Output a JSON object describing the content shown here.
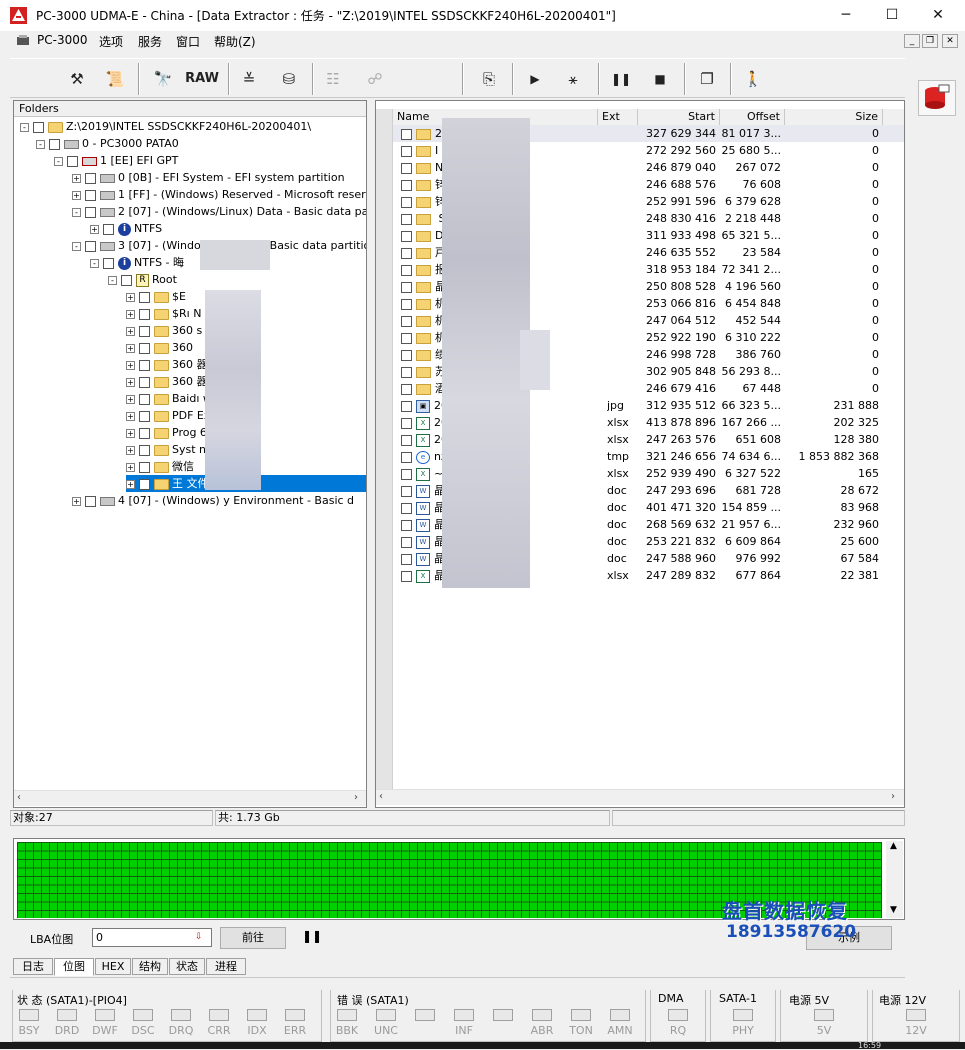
{
  "window": {
    "title": "PC-3000 UDMA-E - China - [Data Extractor : 任务 - \"Z:\\2019\\INTEL SSDSCKKF240H6L-20200401\"]",
    "minimize": "─",
    "maximize": "☐",
    "close": "✕",
    "mdi_min": "_",
    "mdi_restore": "❐",
    "mdi_close": "✕"
  },
  "menu": [
    "PC-3000",
    "选项",
    "服务",
    "窗口",
    "帮助(Z)"
  ],
  "toolbar": {
    "raw_label": "RAW",
    "icons": [
      "tools-icon",
      "scroll-icon",
      "binoculars-icon",
      "raw-button",
      "tree-compare-icon",
      "disk-icon",
      "tree-icon",
      "network-icon",
      "map-disk-icon",
      "play-icon",
      "branch-icon",
      "pause-icon",
      "stop-icon",
      "copy-windows-icon",
      "exit-icon"
    ]
  },
  "folders": {
    "header": "Folders",
    "items": [
      {
        "label": "Z:\\2019\\INTEL SSDSCKKF240H6L-20200401\\",
        "exp": "-",
        "icon": "task",
        "depth": 0
      },
      {
        "label": "0 - PC3000 PATA0",
        "exp": "-",
        "icon": "drive",
        "depth": 1
      },
      {
        "label": "1 [EE] EFI GPT",
        "exp": "-",
        "icon": "gpt",
        "depth": 2
      },
      {
        "label": "0 [0B] - EFI System - EFI system partition",
        "exp": "+",
        "icon": "drive",
        "depth": 3
      },
      {
        "label": "1 [FF] - (Windows) Reserved - Microsoft reserved p",
        "exp": "+",
        "icon": "drive",
        "depth": 3
      },
      {
        "label": "2 [07] - (Windows/Linux) Data - Basic data partition",
        "exp": "-",
        "icon": "drive",
        "depth": 3
      },
      {
        "label": "NTFS",
        "exp": "+",
        "icon": "info",
        "depth": 4
      },
      {
        "label": "3 [07] - (Windo    nux) Data - Basic data partition",
        "exp": "-",
        "icon": "drive",
        "depth": 3
      },
      {
        "label": "NTFS - 晦",
        "exp": "-",
        "icon": "info",
        "depth": 4
      },
      {
        "label": "Root",
        "exp": "-",
        "icon": "root",
        "depth": 5
      },
      {
        "label": "$E",
        "exp": "+",
        "icon": "folder",
        "depth": 6
      },
      {
        "label": "$Rı          N",
        "exp": "+",
        "icon": "folder",
        "depth": 6
      },
      {
        "label": "360          s",
        "exp": "+",
        "icon": "folder",
        "depth": 6
      },
      {
        "label": "360",
        "exp": "+",
        "icon": "folder",
        "depth": 6
      },
      {
        "label": "360          器下载",
        "exp": "+",
        "icon": "folder",
        "depth": 6
      },
      {
        "label": "360          器下载",
        "exp": "+",
        "icon": "folder",
        "depth": 6
      },
      {
        "label": "Baidı          wnload",
        "exp": "+",
        "icon": "folder",
        "depth": 6
      },
      {
        "label": "PDF          Excel工具",
        "exp": "+",
        "icon": "folder",
        "depth": 6
      },
      {
        "label": "Prog          6)",
        "exp": "+",
        "icon": "folder",
        "depth": 6
      },
      {
        "label": "Syst          nformation",
        "exp": "+",
        "icon": "folder",
        "depth": 6
      },
      {
        "label": "微信",
        "exp": "+",
        "icon": "folder",
        "depth": 6
      },
      {
        "label": "王          文件夹",
        "exp": "+",
        "icon": "folder",
        "depth": 6,
        "selected": true
      },
      {
        "label": "4 [07] - (Windows)       y Environment - Basic d",
        "exp": "+",
        "icon": "drive",
        "depth": 3
      }
    ]
  },
  "files": {
    "columns": [
      "Name",
      "Ext",
      "Start",
      "Offset",
      "Size"
    ],
    "rows": [
      {
        "name": "2",
        "ext": "",
        "start": "327 629 344",
        "offset": "81 017 3...",
        "size": "0",
        "type": "folder"
      },
      {
        "name": "I",
        "ext": "",
        "start": "272 292 560",
        "offset": "25 680 5...",
        "size": "0",
        "type": "folder"
      },
      {
        "name": "N",
        "ext": "",
        "start": "246 879 040",
        "offset": "267 072",
        "size": "0",
        "type": "folder"
      },
      {
        "name": "锌",
        "ext": "",
        "start": "246 688 576",
        "offset": "76 608",
        "size": "0",
        "type": "folder"
      },
      {
        "name": "锌          息登录",
        "ext": "",
        "start": "252 991 596",
        "offset": "6 379 628",
        "size": "0",
        "type": "folder"
      },
      {
        "name": "          Selina",
        "ext": "",
        "start": "248 830 416",
        "offset": "2 218 448",
        "size": "0",
        "type": "folder"
      },
      {
        "name": "D          –",
        "ext": "",
        "start": "311 933 498",
        "offset": "65 321 5...",
        "size": "0",
        "type": "folder"
      },
      {
        "name": "戸",
        "ext": "",
        "start": "246 635 552",
        "offset": "23 584",
        "size": "0",
        "type": "folder"
      },
      {
        "name": "报",
        "ext": "",
        "start": "318 953 184",
        "offset": "72 341 2...",
        "size": "0",
        "type": "folder"
      },
      {
        "name": "晶",
        "ext": "",
        "start": "250 808 528",
        "offset": "4 196 560",
        "size": "0",
        "type": "folder"
      },
      {
        "name": "机",
        "ext": "",
        "start": "253 066 816",
        "offset": "6 454 848",
        "size": "0",
        "type": "folder"
      },
      {
        "name": "机",
        "ext": "",
        "start": "247 064 512",
        "offset": "452 544",
        "size": "0",
        "type": "folder"
      },
      {
        "name": "机",
        "ext": "",
        "start": "252 922 190",
        "offset": "6 310 222",
        "size": "0",
        "type": "folder"
      },
      {
        "name": "绩",
        "ext": "",
        "start": "246 998 728",
        "offset": "386 760",
        "size": "0",
        "type": "folder"
      },
      {
        "name": "苏",
        "ext": "",
        "start": "302 905 848",
        "offset": "56 293 8...",
        "size": "0",
        "type": "folder"
      },
      {
        "name": "酒",
        "ext": "",
        "start": "246 679 416",
        "offset": "67 448",
        "size": "0",
        "type": "folder"
      },
      {
        "name": "20          .jpg",
        "ext": "jpg",
        "start": "312 935 512",
        "offset": "66 323 5...",
        "size": "231 888",
        "type": "jpg"
      },
      {
        "name": "20          汇总-王...",
        "ext": "xlsx",
        "start": "413 878 896",
        "offset": "167 266 ...",
        "size": "202 325",
        "type": "xlsx"
      },
      {
        "name": "20          汇总-龚...",
        "ext": "xlsx",
        "start": "247 263 576",
        "offset": "651 608",
        "size": "128 380",
        "type": "xlsx"
      },
      {
        "name": "nzp",
        "ext": "tmp",
        "start": "321 246 656",
        "offset": "74 634 6...",
        "size": "1 853 882 368",
        "type": "tmp"
      },
      {
        "name": "~$2          备清单...",
        "ext": "xlsx",
        "start": "252 939 490",
        "offset": "6 327 522",
        "size": "165",
        "type": "xlsx"
      },
      {
        "name": "晶",
        "ext": "doc",
        "start": "247 293 696",
        "offset": "681 728",
        "size": "28 672",
        "type": "doc"
      },
      {
        "name": "晶          doc",
        "ext": "doc",
        "start": "401 471 320",
        "offset": "154 859 ...",
        "size": "83 968",
        "type": "doc"
      },
      {
        "name": "晶          (中英...",
        "ext": "doc",
        "start": "268 569 632",
        "offset": "21 957 6...",
        "size": "232 960",
        "type": "doc"
      },
      {
        "name": "晶          地址...",
        "ext": "doc",
        "start": "253 221 832",
        "offset": "6 609 864",
        "size": "25 600",
        "type": "doc"
      },
      {
        "name": "晶",
        "ext": "doc",
        "start": "247 588 960",
        "offset": "976 992",
        "size": "67 584",
        "type": "doc"
      },
      {
        "name": "晶",
        "ext": "xlsx",
        "start": "247 289 832",
        "offset": "677 864",
        "size": "22 381",
        "type": "xlsx"
      }
    ]
  },
  "status": {
    "objects": "对象:27",
    "total": "共: 1.73 Gb"
  },
  "lba": {
    "label": "LBA位图",
    "value": "0",
    "goto_label": "前往",
    "pause": "❚❚",
    "example_label": "示例"
  },
  "watermark": {
    "line1": "盘首数据恢复",
    "line2": "18913587620"
  },
  "tabs": [
    {
      "label": "日志",
      "active": false
    },
    {
      "label": "位图",
      "active": true
    },
    {
      "label": "HEX",
      "active": false
    },
    {
      "label": "结构",
      "active": false
    },
    {
      "label": "状态",
      "active": false
    },
    {
      "label": "进程",
      "active": false
    }
  ],
  "indicators": {
    "status_title": "状 态 (SATA1)-[PIO4]",
    "status_leds": [
      "BSY",
      "DRD",
      "DWF",
      "DSC",
      "DRQ",
      "CRR",
      "IDX",
      "ERR"
    ],
    "error_title": "错 误 (SATA1)",
    "error_leds": [
      "BBK",
      "UNC",
      "",
      "INF",
      "",
      "ABR",
      "TON",
      "AMN"
    ],
    "dma_title": "DMA",
    "dma_leds": [
      "RQ"
    ],
    "sata_title": "SATA-1",
    "sata_leds": [
      "PHY"
    ],
    "p5_title": "电源 5V",
    "p5_leds": [
      "5V"
    ],
    "p12_title": "电源 12V",
    "p12_leds": [
      "12V"
    ]
  },
  "clock": "16:59",
  "colors": {
    "bitmap_green": "#00d000",
    "selection": "#0078d7",
    "watermark": "#1a4fb8"
  }
}
